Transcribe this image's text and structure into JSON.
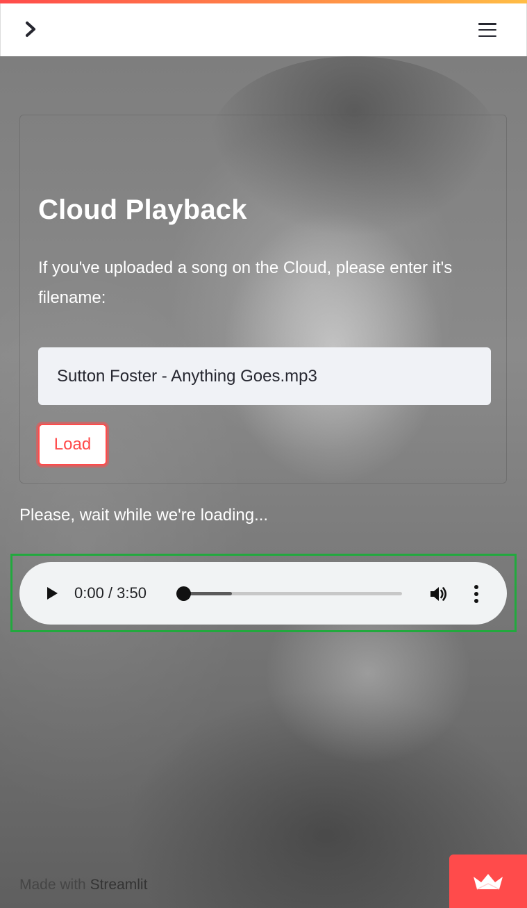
{
  "header": {
    "sidebar_toggle_icon": "chevron-right-icon",
    "menu_icon": "hamburger-menu-icon",
    "accent_stripe_colors": [
      "#ff4b4b",
      "#ffbd45"
    ]
  },
  "main": {
    "title": "Cloud Playback",
    "instructions": "If you've uploaded a song on the Cloud, please enter it's filename:",
    "filename_input": {
      "value": "Sutton Foster - Anything Goes.mp3"
    },
    "load_button_label": "Load",
    "status_text": "Please, wait while we're loading..."
  },
  "audio_player": {
    "time_display": "0:00 / 3:50",
    "played_fraction": 0.0,
    "buffered_fraction": 0.24,
    "play_icon": "play-icon",
    "volume_icon": "volume-icon",
    "more_icon": "more-vertical-icon"
  },
  "footer": {
    "made_with": "Made with",
    "brand": "Streamlit"
  },
  "colors": {
    "accent": "#ff4b4b",
    "highlight_border": "#22a93e",
    "input_bg": "#f0f2f6"
  }
}
